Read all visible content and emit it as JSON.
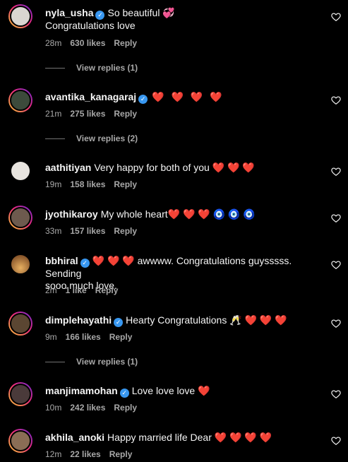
{
  "comments": [
    {
      "user": "nyla_usha",
      "verified": true,
      "text": "So beautiful 💞",
      "text2": "Congratulations love",
      "time": "28m",
      "likes": "630 likes",
      "reply": "Reply",
      "view_replies": "View replies (1)",
      "avatar_color": "#d9d6d1",
      "story": true
    },
    {
      "user": "avantika_kanagaraj",
      "verified": true,
      "text": "❤️ ❤️ ❤️ ❤️",
      "time": "21m",
      "likes": "275 likes",
      "reply": "Reply",
      "view_replies": "View replies (2)",
      "avatar_color": "#3c4a3b",
      "story": true
    },
    {
      "user": "aathitiyan",
      "verified": false,
      "text": "Very happy for both of you ❤️ ❤️ ❤️",
      "time": "19m",
      "likes": "158 likes",
      "reply": "Reply",
      "avatar_color": "#e8e4df",
      "story": false
    },
    {
      "user": "jyothikaroy",
      "verified": false,
      "text": "My whole heart❤️ ❤️ ❤️ 🧿 🧿 🧿",
      "time": "33m",
      "likes": "157 likes",
      "reply": "Reply",
      "avatar_color": "#6d5a4e",
      "story": true
    },
    {
      "user": "bbhiral",
      "verified": true,
      "text": "❤️ ❤️ ❤️ awwww. Congratulations guysssss. Sending",
      "text2": "sooo much love.",
      "time": "2m",
      "likes": "1 like",
      "reply": "Reply",
      "avatar_color": "#b06a2b",
      "story": false
    },
    {
      "user": "dimplehayathi",
      "verified": true,
      "text": "Hearty Congratulations 🥂 ❤️ ❤️ ❤️",
      "time": "9m",
      "likes": "166 likes",
      "reply": "Reply",
      "view_replies": "View replies (1)",
      "avatar_color": "#5b4632",
      "story": true
    },
    {
      "user": "manjimamohan",
      "verified": true,
      "text": "Love love love ❤️",
      "time": "10m",
      "likes": "242 likes",
      "reply": "Reply",
      "avatar_color": "#4a3a3a",
      "story": true
    },
    {
      "user": "akhila_anoki",
      "verified": false,
      "text": "Happy married life Dear ❤️ ❤️ ❤️ ❤️",
      "time": "12m",
      "likes": "22 likes",
      "reply": "Reply",
      "avatar_color": "#8a6d55",
      "story": true
    }
  ],
  "icons": {
    "like": "heart-outline-icon",
    "verified": "verified-badge-icon"
  },
  "colors": {
    "background": "#000000",
    "muted": "#a8a8a8",
    "verified": "#3897f0",
    "heart": "#ff2d3a"
  }
}
